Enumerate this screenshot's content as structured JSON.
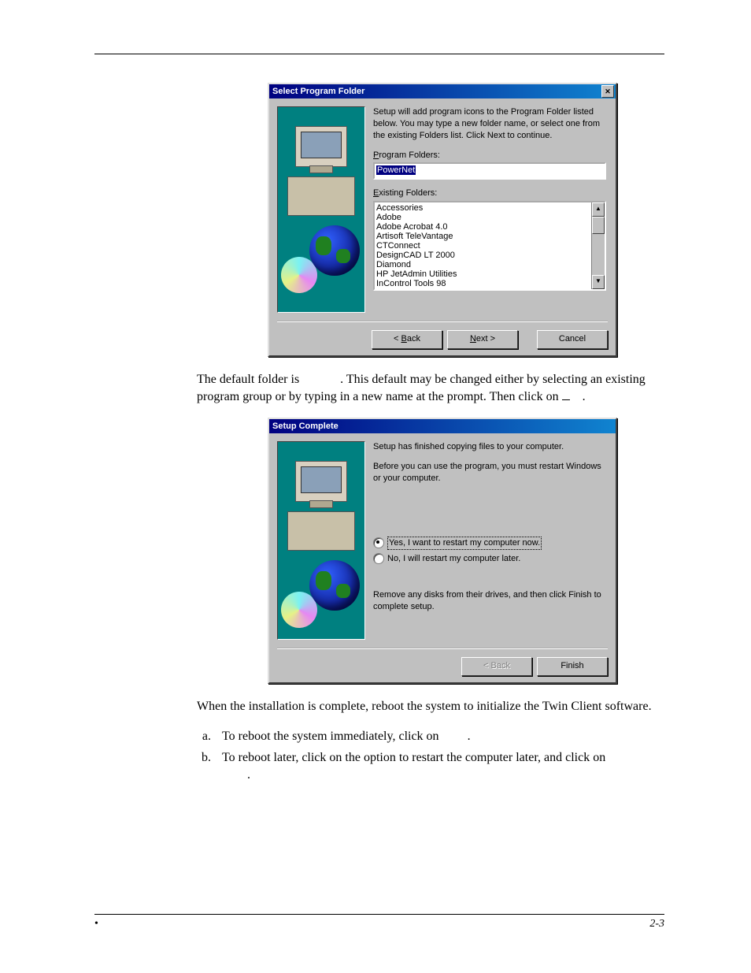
{
  "dialog1": {
    "title": "Select Program Folder",
    "intro": "Setup will add program icons to the Program Folder listed below. You may type a new folder name, or select one from the existing Folders list.  Click Next to continue.",
    "program_folders_label_pre": "P",
    "program_folders_label_post": "rogram Folders:",
    "program_folder_value": "PowerNet",
    "existing_label_pre": "E",
    "existing_label_post": "xisting Folders:",
    "existing_folders": [
      "Accessories",
      "Adobe",
      "Adobe Acrobat 4.0",
      "Artisoft TeleVantage",
      "CTConnect",
      "DesignCAD LT 2000",
      "Diamond",
      "HP JetAdmin Utilities",
      "InControl Tools 98"
    ],
    "back_pre": "< ",
    "back_u": "B",
    "back_post": "ack",
    "next_u": "N",
    "next_post": "ext >",
    "cancel": "Cancel"
  },
  "para1": {
    "a": "The default folder is ",
    "b": ". This default may be changed either by selecting an existing program group or by typing in a new name at the prompt. Then click on ",
    "c": "."
  },
  "dialog2": {
    "title": "Setup Complete",
    "line1": "Setup has finished copying files to your computer.",
    "line2": "Before you can use the program, you must restart Windows or your computer.",
    "opt_yes": "Yes, I want to restart my computer now.",
    "opt_no": "No, I will restart my computer later.",
    "line3": "Remove any disks from their drives, and then click Finish to complete setup.",
    "back": "< Back",
    "finish": "Finish"
  },
  "para2": "When the installation is complete, reboot the system to initialize the Twin Client software.",
  "list": {
    "a": "To reboot the system immediately, click on ",
    "a_end": ".",
    "b": "To reboot later, click on the option to restart the computer later, and click on ",
    "b_end": "."
  },
  "footer": {
    "left_sep": "•",
    "right": "2-3"
  }
}
